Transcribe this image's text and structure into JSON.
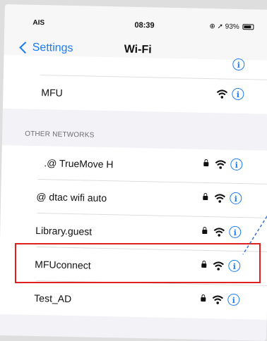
{
  "status_bar": {
    "carrier": "AIS",
    "time": "08:39",
    "battery": "93%"
  },
  "nav": {
    "back_label": "Settings",
    "title": "Wi-Fi"
  },
  "networks": [
    {
      "name": "MFU",
      "secured": false
    },
    {
      "name": ".@ TrueMove H",
      "secured": true
    },
    {
      "name": "@ dtac wifi auto",
      "secured": true
    },
    {
      "name": "Library.guest",
      "secured": true
    },
    {
      "name": "MFUconnect",
      "secured": true,
      "highlighted": true
    },
    {
      "name": "Test_AD",
      "secured": true
    }
  ],
  "section": {
    "other_networks": "OTHER NETWORKS"
  },
  "icons": {
    "info": "info-icon",
    "wifi": "wifi-icon",
    "lock": "lock-icon"
  },
  "colors": {
    "accent": "#1a7cf5",
    "highlight": "#e02020"
  }
}
